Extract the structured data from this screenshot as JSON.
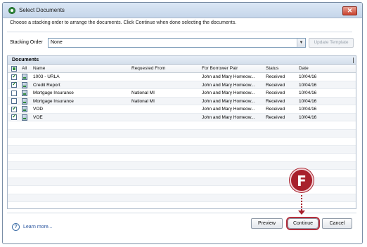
{
  "window": {
    "title": "Select Documents",
    "close_glyph": "✕"
  },
  "instruction": "Choose a stacking order to arrange the documents. Click Continue when done selecting the documents.",
  "stacking": {
    "label": "Stacking Order",
    "value": "None",
    "update_button": "Update Template"
  },
  "documents": {
    "section_label": "Documents",
    "columns": [
      "All",
      "Name",
      "Requested From",
      "For Borrower Pair",
      "Status",
      "Date"
    ],
    "rows": [
      {
        "checked": true,
        "name": "1003 - URLA",
        "requested_from": "",
        "borrower_pair": "John and Mary Homeow...",
        "status": "Received",
        "date": "10/04/16"
      },
      {
        "checked": true,
        "name": "Credit Report",
        "requested_from": "",
        "borrower_pair": "John and Mary Homeow...",
        "status": "Received",
        "date": "10/04/16"
      },
      {
        "checked": false,
        "name": "Mortgage Insurance",
        "requested_from": "National MI",
        "borrower_pair": "John and Mary Homeow...",
        "status": "Received",
        "date": "10/04/16"
      },
      {
        "checked": false,
        "name": "Mortgage Insurance",
        "requested_from": "National MI",
        "borrower_pair": "John and Mary Homeow...",
        "status": "Received",
        "date": "10/04/16"
      },
      {
        "checked": true,
        "name": "VOD",
        "requested_from": "",
        "borrower_pair": "John and Mary Homeow...",
        "status": "Received",
        "date": "10/04/16"
      },
      {
        "checked": true,
        "name": "VOE",
        "requested_from": "",
        "borrower_pair": "John and Mary Homeow...",
        "status": "Received",
        "date": "10/04/16"
      }
    ]
  },
  "footer": {
    "learn_more": "Learn more...",
    "preview": "Preview",
    "continue": "Continue",
    "cancel": "Cancel"
  },
  "callout": {
    "letter": "F"
  },
  "colors": {
    "callout": "#a8202c",
    "titlebar": "#c6d6ea",
    "link": "#2c57a0"
  }
}
